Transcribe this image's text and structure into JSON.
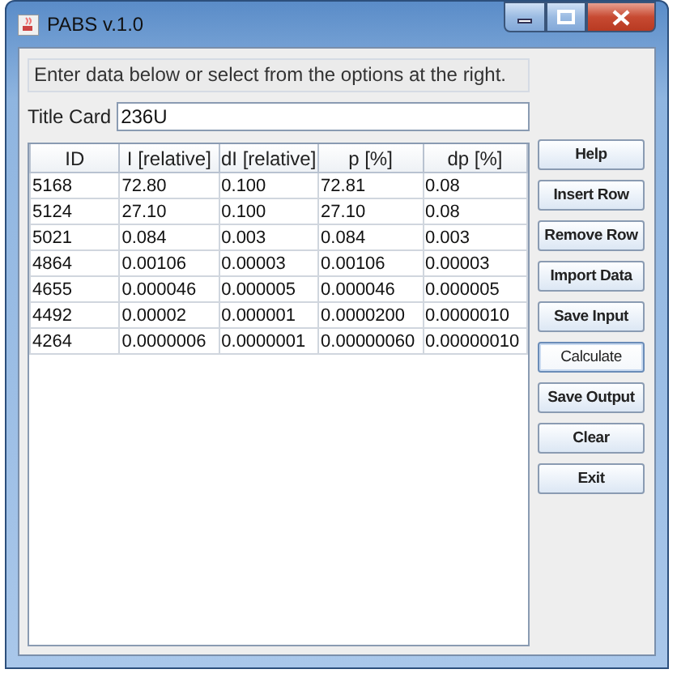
{
  "window": {
    "title": "PABS v.1.0"
  },
  "instruction": "Enter data below or select from the options at the right.",
  "title_card": {
    "label": "Title Card",
    "value": "236U"
  },
  "table": {
    "columns": [
      "ID",
      "I [relative]",
      "dI [relative]",
      "p [%]",
      "dp [%]"
    ],
    "rows": [
      [
        "5168",
        "72.80",
        "0.100",
        "72.81",
        "0.08"
      ],
      [
        "5124",
        "27.10",
        "0.100",
        "27.10",
        "0.08"
      ],
      [
        "5021",
        "0.084",
        "0.003",
        "0.084",
        "0.003"
      ],
      [
        "4864",
        "0.00106",
        "0.00003",
        "0.00106",
        "0.00003"
      ],
      [
        "4655",
        "0.000046",
        "0.000005",
        "0.000046",
        "0.000005"
      ],
      [
        "4492",
        "0.00002",
        "0.000001",
        "0.0000200",
        "0.0000010"
      ],
      [
        "4264",
        "0.0000006",
        "0.0000001",
        "0.00000060",
        "0.00000010"
      ]
    ]
  },
  "buttons": [
    {
      "label": "Help",
      "focused": false
    },
    {
      "label": "Insert Row",
      "focused": false
    },
    {
      "label": "Remove Row",
      "focused": false
    },
    {
      "label": "Import Data",
      "focused": false
    },
    {
      "label": "Save Input",
      "focused": false
    },
    {
      "label": "Calculate",
      "focused": true
    },
    {
      "label": "Save Output",
      "focused": false
    },
    {
      "label": "Clear",
      "focused": false
    },
    {
      "label": "Exit",
      "focused": false
    }
  ]
}
